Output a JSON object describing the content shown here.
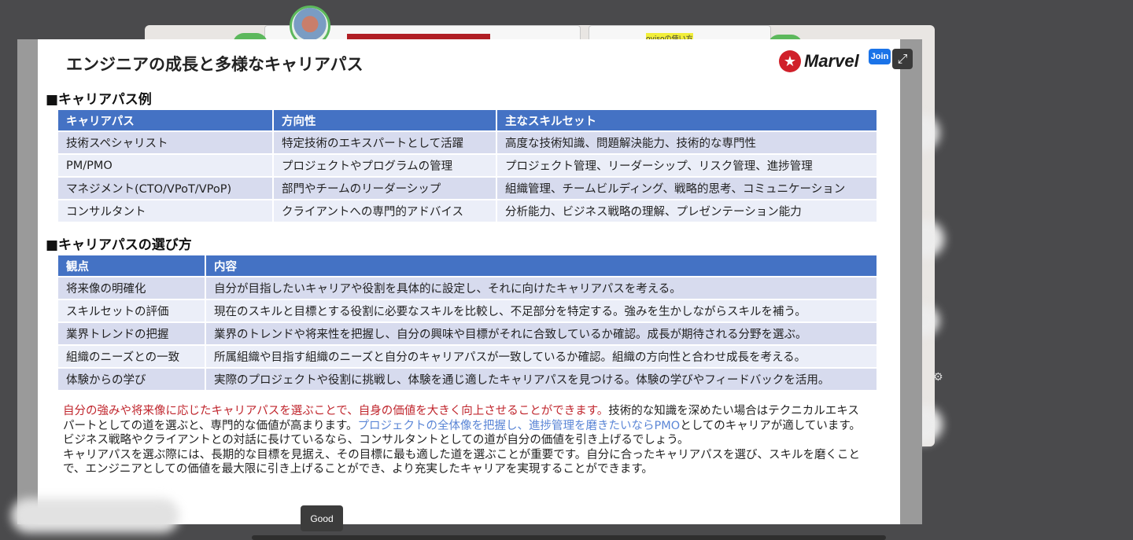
{
  "background_tab": {
    "label": "ovisoの使い方"
  },
  "slide": {
    "title": "エンジニアの成長と多様なキャリアパス",
    "logo_text": "Marvel",
    "section1_heading": "■キャリアパス例",
    "table1": {
      "headers": [
        "キャリアパス",
        "方向性",
        "主なスキルセット"
      ],
      "rows": [
        [
          "技術スペシャリスト",
          "特定技術のエキスパートとして活躍",
          "高度な技術知識、問題解決能力、技術的な専門性"
        ],
        [
          "PM/PMO",
          "プロジェクトやプログラムの管理",
          "プロジェクト管理、リーダーシップ、リスク管理、進捗管理"
        ],
        [
          "マネジメント(CTO/VPoT/VPoP)",
          "部門やチームのリーダーシップ",
          "組織管理、チームビルディング、戦略的思考、コミュニケーション"
        ],
        [
          "コンサルタント",
          "クライアントへの専門的アドバイス",
          "分析能力、ビジネス戦略の理解、プレゼンテーション能力"
        ]
      ]
    },
    "section2_heading": "■キャリアパスの選び方",
    "table2": {
      "headers": [
        "観点",
        "内容"
      ],
      "rows": [
        [
          "将来像の明確化",
          "自分が目指したいキャリアや役割を具体的に設定し、それに向けたキャリアパスを考える。"
        ],
        [
          "スキルセットの評価",
          "現在のスキルと目標とする役割に必要なスキルを比較し、不足部分を特定する。強みを生かしながらスキルを補う。"
        ],
        [
          "業界トレンドの把握",
          "業界のトレンドや将来性を把握し、自分の興味や目標がそれに合致しているか確認。成長が期待される分野を選ぶ。"
        ],
        [
          "組織のニーズとの一致",
          "所属組織や目指す組織のニーズと自分のキャリアパスが一致しているか確認。組織の方向性と合わせ成長を考える。"
        ],
        [
          "体験からの学び",
          "実際のプロジェクトや役割に挑戦し、体験を通じ適したキャリアパスを見つける。体験の学びやフィードバックを活用。"
        ]
      ]
    },
    "summary": {
      "red": "自分の強みや将来像に応じたキャリアパスを選ぶことで、自身の価値を大きく向上させることができます。",
      "part2": "技術的な知識を深めたい場合はテクニカルエキスパートとしての道を選ぶと、専門的な価値が高まります。",
      "blue": "プロジェクトの全体像を把握し、進捗管理を磨きたいならPMO",
      "part4": "としてのキャリアが適しています。ビジネス戦略やクライアントとの対話に長けているなら、コンサルタントとしての道が自分の価値を引き上げるでしょう。",
      "part5": "キャリアパスを選ぶ際には、長期的な目標を見据え、その目標に最も適した道を選ぶことが重要です。自分に合ったキャリアパスを選び、スキルを磨くことで、エンジニアとしての価値を最大限に引き上げることができ、より充実したキャリアを実現することができます。"
    }
  },
  "controls": {
    "join_label": "Join",
    "expand_icon": "⤢",
    "good_label": "Good"
  },
  "colors": {
    "table_header": "#4472c4",
    "row_odd": "#d7dbee",
    "row_even": "#ebeef8",
    "summary_red": "#c0262d",
    "summary_blue": "#5b86d6",
    "join_button": "#1a73e8"
  }
}
